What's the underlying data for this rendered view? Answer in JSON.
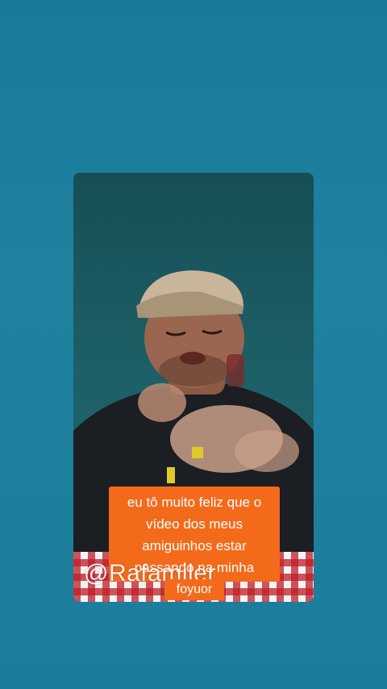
{
  "video": {
    "caption_lines": [
      "eu tô muito feliz que o",
      "vídeo dos meus",
      "amiguinhos estar",
      "passando na minha"
    ],
    "caption_tail": "foyuor",
    "watermark": "@Rafamiler"
  },
  "colors": {
    "background": "#1d809f",
    "caption_bg": "#f46a1b",
    "video_bg": "#1d5f66"
  }
}
